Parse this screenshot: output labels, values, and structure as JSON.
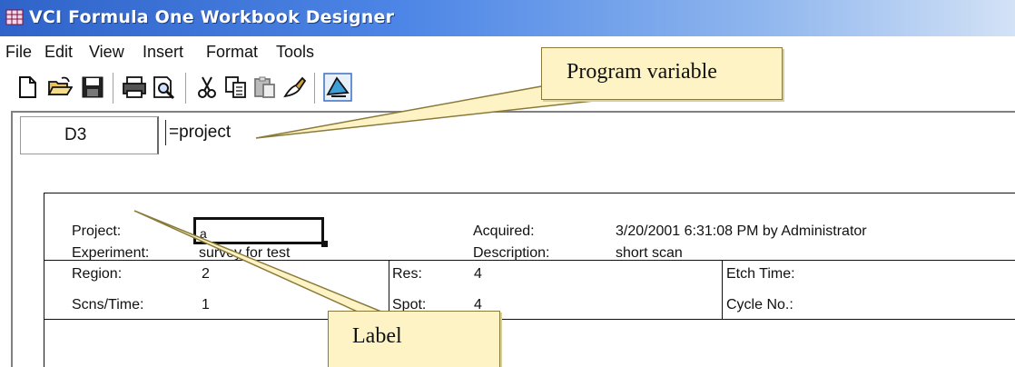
{
  "window": {
    "title": "VCI Formula One Workbook Designer"
  },
  "menu": [
    "File",
    "Edit",
    "View",
    "Insert",
    "Format",
    "Tools"
  ],
  "toolbar": {
    "icons": [
      "new-document-icon",
      "open-folder-icon",
      "save-icon",
      "print-icon",
      "print-preview-icon",
      "cut-icon",
      "copy-icon",
      "paste-icon",
      "format-painter-icon",
      "designer-mode-icon"
    ]
  },
  "formula_bar": {
    "cell_ref": "D3",
    "formula": "=project"
  },
  "sheet": {
    "header": {
      "project_label": "Project:",
      "project_value": "a",
      "experiment_label": "Experiment:",
      "experiment_value": "survey for test",
      "acquired_label": "Acquired:",
      "acquired_value": "3/20/2001 6:31:08 PM by Administrator",
      "description_label": "Description:",
      "description_value": "short scan"
    },
    "rows": {
      "region_label": "Region:",
      "region_value": "2",
      "res_label": "Res:",
      "res_value": "4",
      "etch_label": "Etch Time:",
      "scns_label": "Scns/Time:",
      "scns_value": "1",
      "spot_label": "Spot:",
      "spot_value": "4",
      "cycle_label": "Cycle No.:"
    }
  },
  "callouts": {
    "program_variable": "Program variable",
    "label": "Label"
  },
  "colors": {
    "titlebar": "#2f63c9",
    "callout_fill": "#fdf3c4"
  }
}
